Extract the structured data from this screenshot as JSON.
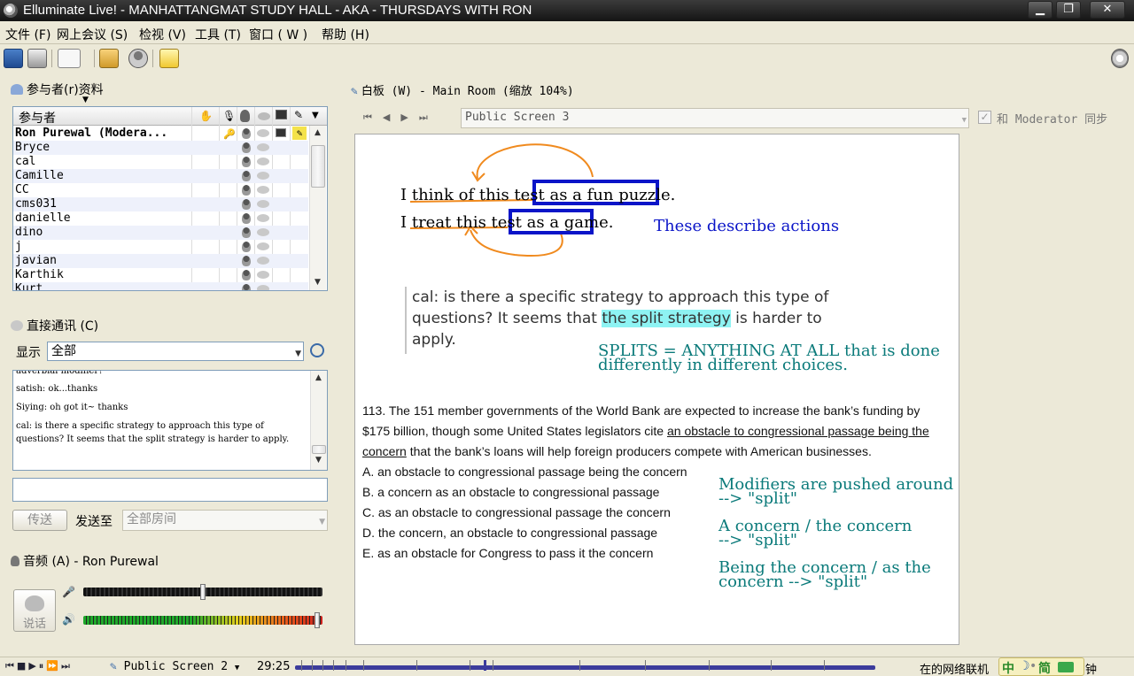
{
  "window": {
    "title": "Elluminate Live! - MANHATTANGMAT STUDY HALL - AKA - THURSDAYS WITH RON",
    "controls": {
      "minimize": "▁",
      "restore": "❐",
      "close": "✕"
    }
  },
  "menu": [
    "文件 (F)",
    "网上会议 (S)",
    "检视 (V)",
    "工具 (T)",
    "窗口 ( W )",
    "帮助 (H)"
  ],
  "participants": {
    "panel_title": "参与者(r)资料",
    "column_header": "参与者",
    "rows": [
      "Ron Purewal (Modera...",
      "Bryce",
      "cal",
      "Camille",
      "CC",
      "cms031",
      "danielle",
      "dino",
      "j",
      "javian",
      "Karthik",
      "Kurt"
    ]
  },
  "chat": {
    "panel_title": "直接通讯 (C)",
    "show_label": "显示",
    "show_value": "全部",
    "messages": [
      "adverbial modifier?",
      "satish: ok...thanks",
      "Siying: oh got it~ thanks",
      "cal: is there a specific strategy to approach this type of questions? It seems that the split strategy is harder to apply."
    ],
    "input_value": "",
    "send_button": "传送",
    "send_to_label": "发送至",
    "send_to_value": "全部房间"
  },
  "audio": {
    "panel_title": "音频 (A) - Ron Purewal",
    "talk_button": "说话",
    "mic_level": 0.5,
    "speaker_level": 0.99
  },
  "whiteboard": {
    "panel_title": "白板 (W) - Main Room (缩放 104%)",
    "screen_select": "Public Screen 3",
    "sync_label": "和 Moderator 同步",
    "sync_checked": true,
    "sentence1": "I think of this test as a fun puzzle.",
    "sentence2": "I treat this test as a game.",
    "note_actions": "These describe actions",
    "quote": {
      "line1": "cal: is there a specific strategy to approach this type of",
      "line2_pre": "questions? It seems that ",
      "line2_highlight": "the split strategy",
      "line2_post": " is harder to",
      "line3": "apply."
    },
    "note_splits_1": "SPLITS = ANYTHING AT ALL that is done",
    "note_splits_2": "differently in different choices.",
    "question": {
      "line1": "113. The 151 member governments of the World Bank are expected to increase the bank’s funding by",
      "line2_pre": "$175 billion, though some United States legislators cite ",
      "line2_underline": "an obstacle to congressional passage being the",
      "line3_underline": "concern",
      "line3_post": " that the bank’s loans will help foreign producers compete with American businesses."
    },
    "choices": [
      "A. an obstacle to congressional passage being the concern",
      "B. a concern as an obstacle to congressional passage",
      "C. as an obstacle to congressional passage the concern",
      "D. the concern, an obstacle to congressional passage",
      "E. as an obstacle for Congress to pass it the concern"
    ],
    "note_mod_1": "Modifiers are pushed around",
    "note_mod_2": "--> \"split\"",
    "note_concern_1": "A concern / the concern",
    "note_concern_2": "--> \"split\"",
    "note_being_1": "Being the concern / as the",
    "note_being_2": "concern --> \"split\""
  },
  "bottom": {
    "screen_select": "Public Screen 2",
    "time": "29:25",
    "status": "在的网络联机",
    "status_tail": "钟",
    "ime": "中",
    "ime_mode": "简"
  },
  "colors": {
    "blue_ink": "#0a14c8",
    "teal_ink": "#0a7a7a",
    "orange_ink": "#f08a1e",
    "highlight": "#8ef3f3",
    "title_bar": "#141414"
  }
}
